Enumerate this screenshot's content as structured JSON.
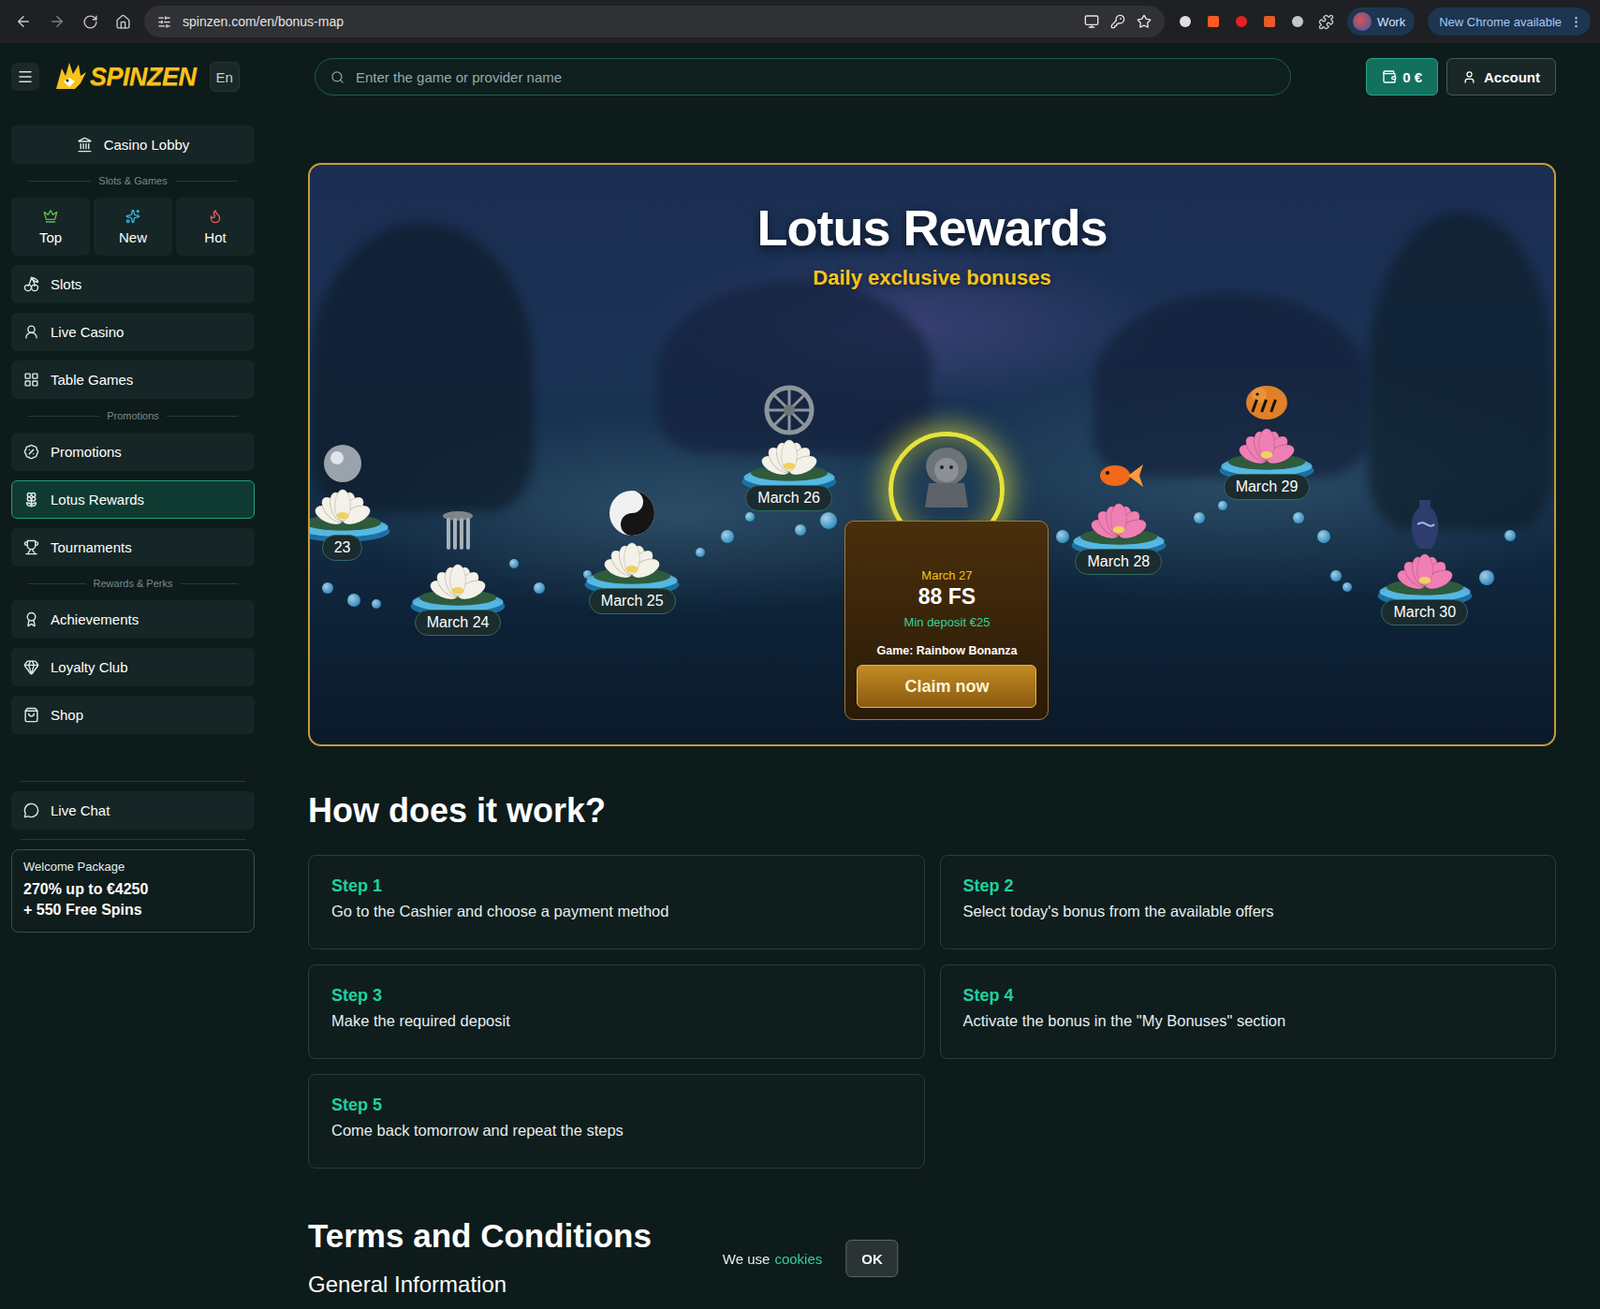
{
  "browser": {
    "url": "spinzen.com/en/bonus-map",
    "profile": "Work",
    "update": "New Chrome available"
  },
  "header": {
    "logo": "SPINZEN",
    "language": "En",
    "search_placeholder": "Enter the game or provider name",
    "balance": "0 €",
    "account": "Account"
  },
  "sidebar": {
    "entries": [
      {
        "kind": "button",
        "label": "Casino Lobby",
        "selected": false
      },
      {
        "kind": "section",
        "label": "Slots & Games"
      },
      {
        "kind": "tabs",
        "items": [
          {
            "label": "Top",
            "selected": false
          },
          {
            "label": "New",
            "selected": false
          },
          {
            "label": "Hot",
            "selected": false
          }
        ]
      },
      {
        "kind": "item",
        "label": "Slots",
        "selected": false
      },
      {
        "kind": "item",
        "label": "Live Casino",
        "selected": false
      },
      {
        "kind": "item",
        "label": "Table Games",
        "selected": false
      },
      {
        "kind": "section",
        "label": "Promotions"
      },
      {
        "kind": "item",
        "label": "Promotions",
        "selected": false
      },
      {
        "kind": "item",
        "label": "Lotus Rewards",
        "selected": true
      },
      {
        "kind": "item",
        "label": "Tournaments",
        "selected": false
      },
      {
        "kind": "section",
        "label": "Rewards & Perks"
      },
      {
        "kind": "item",
        "label": "Achievements",
        "selected": false
      },
      {
        "kind": "item",
        "label": "Loyalty Club",
        "selected": false
      },
      {
        "kind": "item",
        "label": "Shop",
        "selected": false
      }
    ],
    "chat": "Live Chat",
    "welcome": {
      "title": "Welcome Package",
      "lines": [
        "270% up to €4250",
        "+ 550 Free Spins"
      ]
    }
  },
  "banner": {
    "title": "Lotus Rewards",
    "subtitle": "Daily exclusive bonuses",
    "nodes": [
      {
        "label": "23",
        "color": "#f4f1e8",
        "selected": false
      },
      {
        "label": "March 24",
        "color": "#f4f1e8",
        "selected": false
      },
      {
        "label": "March 25",
        "color": "#f4f1e8",
        "selected": false
      },
      {
        "label": "March 26",
        "color": "#f4f1e8",
        "selected": false
      },
      {
        "label": "March 27",
        "selected": true
      },
      {
        "label": "March 28",
        "color": "#ef7fb4",
        "selected": false
      },
      {
        "label": "March 29",
        "color": "#ef7fb4",
        "selected": false
      },
      {
        "label": "March 30",
        "color": "#ef7fb4",
        "selected": false
      }
    ],
    "offer": {
      "amount": "88 FS",
      "min_deposit": "Min deposit €25",
      "game": "Game: Rainbow Bonanza",
      "button": "Claim now"
    }
  },
  "how": {
    "title": "How does it work?",
    "steps": [
      {
        "label": "Step 1",
        "text": "Go to the Cashier and choose a payment method"
      },
      {
        "label": "Step 2",
        "text": "Select today's bonus from the available offers"
      },
      {
        "label": "Step 3",
        "text": "Make the required deposit"
      },
      {
        "label": "Step 4",
        "text": "Activate the bonus in the \"My Bonuses\" section"
      },
      {
        "label": "Step 5",
        "text": "Come back tomorrow and repeat the steps"
      }
    ]
  },
  "terms": {
    "title": "Terms and Conditions",
    "subtitle": "General Information"
  },
  "cookie": {
    "text": "We use",
    "link": "cookies",
    "button": "OK"
  }
}
